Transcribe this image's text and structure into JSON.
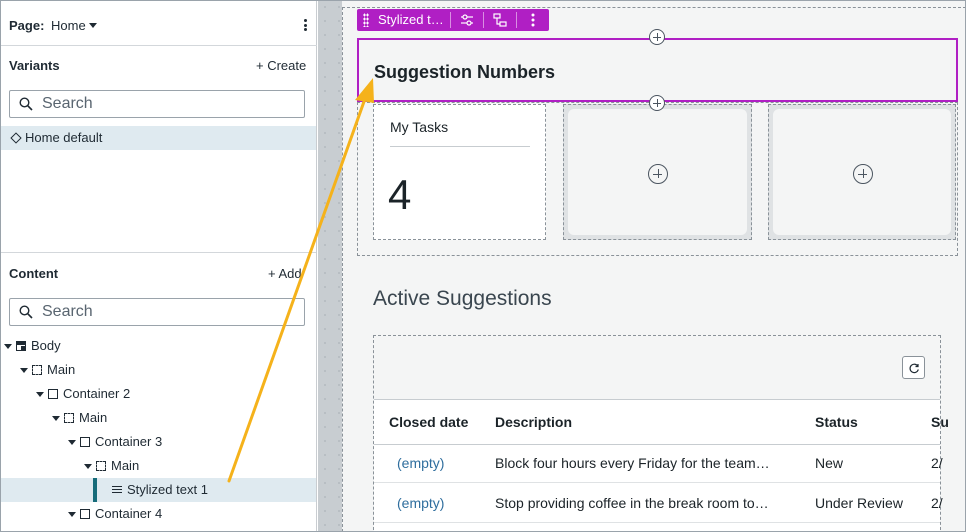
{
  "left_panel": {
    "page_label": "Page:",
    "page_value": "Home",
    "variants": {
      "title": "Variants",
      "create_label": "+ Create",
      "search_placeholder": "Search",
      "items": [
        {
          "label": "Home default",
          "icon": "diamond-icon",
          "selected": true
        }
      ]
    },
    "content": {
      "title": "Content",
      "add_label": "+ Add",
      "search_placeholder": "Search",
      "tree": [
        {
          "label": "Body",
          "icon": "body-layout-icon",
          "expanded": true
        },
        {
          "label": "Main",
          "icon": "dashed-region-icon",
          "expanded": true
        },
        {
          "label": "Container 2",
          "icon": "container-icon",
          "expanded": true
        },
        {
          "label": "Main",
          "icon": "dashed-region-icon",
          "expanded": true
        },
        {
          "label": "Container 3",
          "icon": "container-icon",
          "expanded": true
        },
        {
          "label": "Main",
          "icon": "dashed-region-icon",
          "expanded": true
        },
        {
          "label": "Stylized text 1",
          "icon": "text-lines-icon",
          "selected": true
        },
        {
          "label": "Container 4",
          "icon": "container-icon",
          "expanded": true
        }
      ]
    }
  },
  "canvas": {
    "selection_toolbar": {
      "name": "Stylized t…",
      "icons": [
        "drag-handle-icon",
        "settings-sliders-icon",
        "hierarchy-icon",
        "more-icon"
      ],
      "color": "#b01fc4"
    },
    "heading": "Suggestion Numbers",
    "widget": {
      "title": "My Tasks",
      "value": "4"
    },
    "active_suggestions": {
      "title": "Active Suggestions",
      "columns": [
        "Closed date",
        "Description",
        "Status",
        "Su"
      ],
      "rows": [
        {
          "closed_date": "(empty)",
          "description": "Block four hours every Friday for the team…",
          "status": "New",
          "extra": "2/"
        },
        {
          "closed_date": "(empty)",
          "description": "Stop providing coffee in the break room to…",
          "status": "Under Review",
          "extra": "2/"
        }
      ]
    }
  },
  "colors": {
    "accent": "#b01fc4",
    "selection_bar": "#176c7a",
    "arrow": "#f5b21b",
    "link": "#2f6e9e"
  }
}
